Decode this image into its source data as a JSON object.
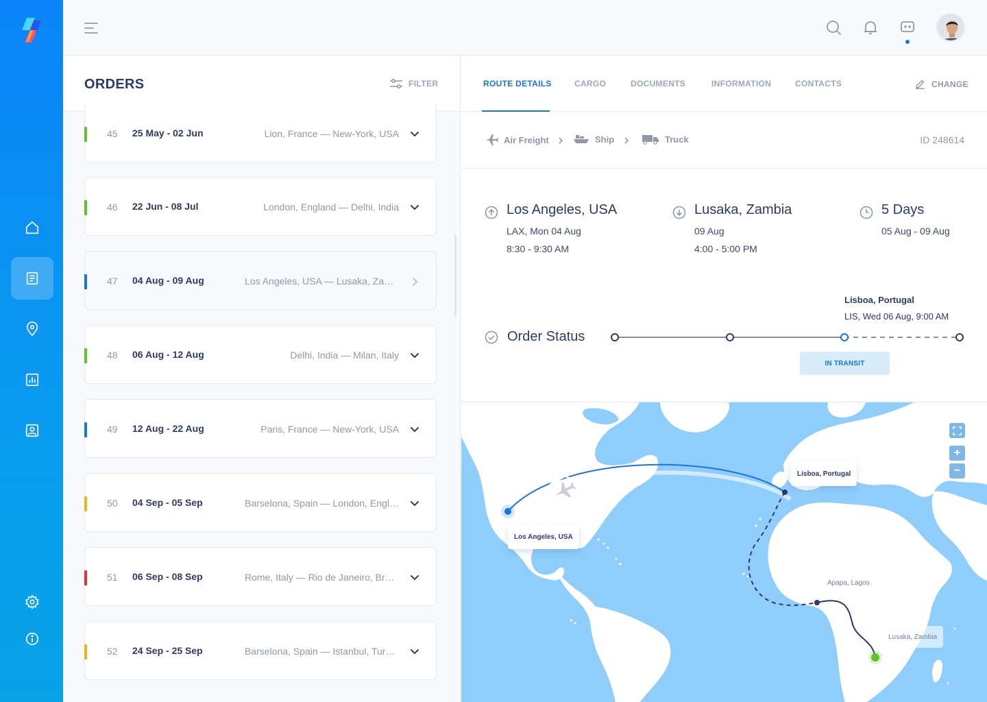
{
  "topbar": {
    "icons": [
      "menu-icon",
      "search-icon",
      "bell-icon",
      "chat-icon"
    ]
  },
  "sidebar": {
    "items": [
      "home-icon",
      "orders-icon",
      "location-icon",
      "chart-icon",
      "contacts-icon",
      "settings-icon",
      "info-icon"
    ],
    "active": "orders-icon"
  },
  "orders": {
    "title": "ORDERS",
    "filter_label": "FILTER",
    "list": [
      {
        "num": "45",
        "dates": "25 May - 02 Jun",
        "route": "Lion, France — New-York, USA",
        "color": "#5ec427"
      },
      {
        "num": "46",
        "dates": "22 Jun - 08 Jul",
        "route": "London, England — Delhi, India",
        "color": "#5ec427"
      },
      {
        "num": "47",
        "dates": "04 Aug - 09 Aug",
        "route": "Los Angeles, USA — Lusaka, Zambia",
        "color": "#1574e8"
      },
      {
        "num": "48",
        "dates": "06 Aug - 12 Aug",
        "route": "Delhi, India — Milan, Italy",
        "color": "#5ec427"
      },
      {
        "num": "49",
        "dates": "12 Aug - 22 Aug",
        "route": "Paris, France — New-York, USA",
        "color": "#1574e8"
      },
      {
        "num": "50",
        "dates": "04 Sep - 05 Sep",
        "route": "Barselona, Spain — London, England",
        "color": "#f2b316"
      },
      {
        "num": "51",
        "dates": "06 Sep - 08 Sep",
        "route": "Rome, Italy — Rio de Janeiro, Brazil",
        "color": "#e5322e"
      },
      {
        "num": "52",
        "dates": "24 Sep - 25 Sep",
        "route": "Barselona, Spain — Istanbul, Turkey",
        "color": "#f2b316"
      }
    ]
  },
  "details": {
    "tabs": [
      "ROUTE DETAILS",
      "CARGO",
      "DOCUMENTS",
      "INFORMATION",
      "CONTACTS"
    ],
    "change_label": "CHANGE",
    "modes": [
      "Air Freight",
      "Ship",
      "Truck"
    ],
    "order_id": "ID 248614",
    "origin": {
      "city": "Los Angeles, USA",
      "line1": "LAX, Mon 04 Aug",
      "line2": "8:30 - 9:30 AM"
    },
    "destination": {
      "city": "Lusaka, Zambia",
      "line1": "09 Aug",
      "line2": "4:00 - 5:00 PM"
    },
    "duration": {
      "title": "5 Days",
      "line1": "05 Aug - 09 Aug"
    },
    "status": {
      "label": "Order Status",
      "waypoint_city": "Lisboa, Portugal",
      "waypoint_time": "LIS, Wed 06 Aug, 9:00 AM",
      "badge": "IN TRANSIT",
      "progress": 0.67
    }
  },
  "map": {
    "labels": {
      "origin": "Los Angeles, USA",
      "lisbon": "Lisboa, Portugal",
      "lagos": "Apapa, Lagos",
      "lusaka": "Lusaka, Zambia"
    },
    "controls": [
      "expand-icon",
      "+",
      "−"
    ]
  },
  "colors": {
    "accent": "#1574e8",
    "green": "#5ec427",
    "yellow": "#f2b316",
    "red": "#e5322e",
    "text": "#2b3a67",
    "muted": "#8e99ad"
  }
}
